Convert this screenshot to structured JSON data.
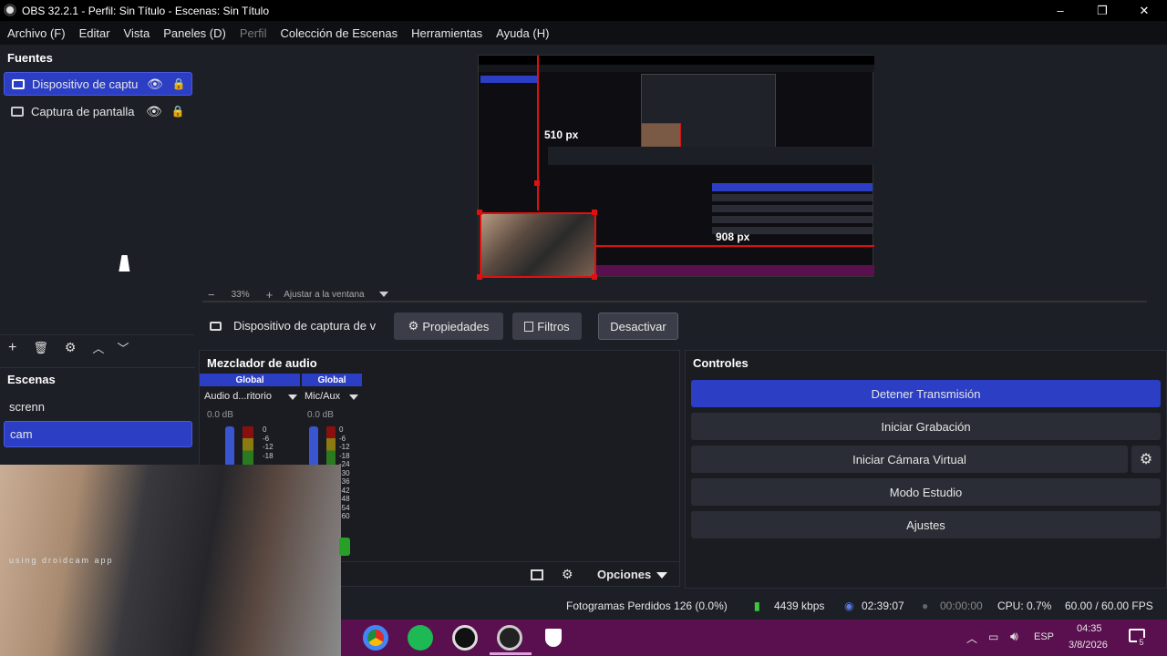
{
  "window": {
    "title": "OBS 32.2.1 - Perfil: Sin Título - Escenas: Sin Título",
    "controls": [
      "–",
      "❐",
      "✕"
    ]
  },
  "menu": [
    "Archivo (F)",
    "Editar",
    "Vista",
    "Paneles (D)",
    "Perfil",
    "Colección de Escenas",
    "Herramientas",
    "Ayuda (H)"
  ],
  "sources": {
    "title": "Fuentes",
    "items": [
      {
        "label": "Dispositivo de captu",
        "selected": true,
        "icon": "camera-icon"
      },
      {
        "label": "Captura de pantalla",
        "selected": false,
        "icon": "monitor-icon"
      }
    ]
  },
  "scenes": {
    "title": "Escenas",
    "items": [
      {
        "label": "screnn",
        "selected": false
      },
      {
        "label": "cam",
        "selected": true
      }
    ]
  },
  "preview": {
    "zoom": "33%",
    "fit_label": "Ajustar a la ventana",
    "label_510": "510 px",
    "label_908": "908 px"
  },
  "source_toolbar": {
    "name": "Dispositivo de captura de v",
    "properties": "Propiedades",
    "filters": "Filtros",
    "deactivate": "Desactivar"
  },
  "mixer": {
    "title": "Mezclador de audio",
    "channels": [
      {
        "tag": "Global",
        "name": "Audio d...ritorio",
        "db": "0.0 dB"
      },
      {
        "tag": "Global",
        "name": "Mic/Aux",
        "db": "0.0 dB"
      }
    ],
    "scale": [
      "0",
      "-6",
      "-12",
      "-18",
      "-24",
      "-30",
      "-36",
      "-42",
      "-48",
      "-54",
      "-60"
    ],
    "options": "Opciones"
  },
  "controls": {
    "title": "Controles",
    "stop_stream": "Detener Transmisión",
    "start_record": "Iniciar Grabación",
    "virtual_cam": "Iniciar Cámara Virtual",
    "studio_mode": "Modo Estudio",
    "settings": "Ajustes"
  },
  "status": {
    "dropped": "Fotogramas Perdidos 126 (0.0%)",
    "bitrate": "4439 kbps",
    "stream_time": "02:39:07",
    "rec_time": "00:00:00",
    "cpu": "CPU: 0.7%",
    "fps": "60.00 / 60.00 FPS"
  },
  "webcam_overlay_text": "using droidcam app",
  "taskbar": {
    "lang": "ESP",
    "time": "04:35",
    "date": "3/8/2026",
    "notif_count": "5"
  },
  "colors": {
    "accent": "#2b3ec4",
    "taskbar": "#5a0f4f",
    "titlebar": "#000000"
  }
}
